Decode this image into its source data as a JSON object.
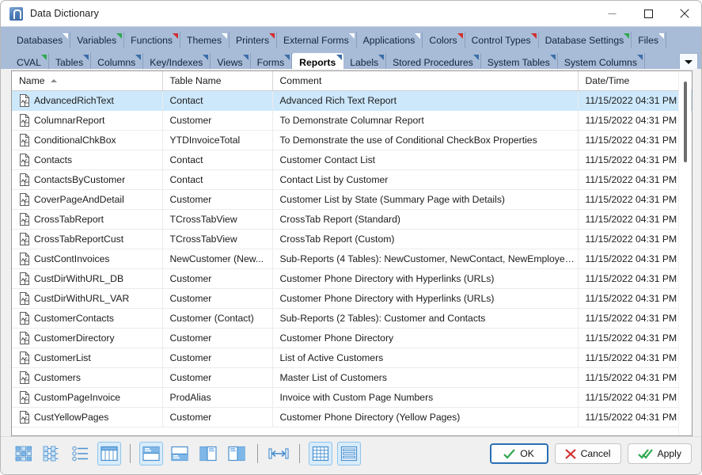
{
  "window": {
    "title": "Data Dictionary",
    "icon": "app-icon",
    "minimize_label": "—",
    "maximize_label": "□",
    "close_label": "✕"
  },
  "tabs": {
    "row1": [
      {
        "label": "Databases",
        "flag": "#ffffff"
      },
      {
        "label": "Variables",
        "flag": "#2fa84f"
      },
      {
        "label": "Functions",
        "flag": "#d32f2f"
      },
      {
        "label": "Themes",
        "flag": "#ffffff"
      },
      {
        "label": "Printers",
        "flag": "#d32f2f"
      },
      {
        "label": "External Forms",
        "flag": "#ffffff"
      },
      {
        "label": "Applications",
        "flag": "#ffffff"
      },
      {
        "label": "Colors",
        "flag": "#d32f2f"
      },
      {
        "label": "Control Types",
        "flag": "#d32f2f"
      },
      {
        "label": "Database Settings",
        "flag": "#2fa84f"
      },
      {
        "label": "Files",
        "flag": "#ffffff"
      }
    ],
    "row2": [
      {
        "label": "CVAL",
        "flag": "#2fa84f",
        "active": false
      },
      {
        "label": "Tables",
        "flag": "#3c6ea8",
        "active": false
      },
      {
        "label": "Columns",
        "flag": "#3c6ea8",
        "active": false
      },
      {
        "label": "Key/Indexes",
        "flag": "#3c6ea8",
        "active": false
      },
      {
        "label": "Views",
        "flag": "#3c6ea8",
        "active": false
      },
      {
        "label": "Forms",
        "flag": "#3c6ea8",
        "active": false
      },
      {
        "label": "Reports",
        "flag": "#3c6ea8",
        "active": true
      },
      {
        "label": "Labels",
        "flag": "#3c6ea8",
        "active": false
      },
      {
        "label": "Stored Procedures",
        "flag": "#3c6ea8",
        "active": false
      },
      {
        "label": "System Tables",
        "flag": "#3c6ea8",
        "active": false
      },
      {
        "label": "System Columns",
        "flag": "#3c6ea8",
        "active": false
      }
    ],
    "overflow_label": "▼"
  },
  "grid": {
    "columns": [
      "Name",
      "Table Name",
      "Comment",
      "Date/Time"
    ],
    "sort_column": "Name",
    "sort_direction": "ascending",
    "selected_row_index": 0,
    "rows": [
      {
        "name": "AdvancedRichText",
        "table": "Contact",
        "comment": "Advanced Rich Text Report",
        "date": "11/15/2022 04:31 PM"
      },
      {
        "name": "ColumnarReport",
        "table": "Customer",
        "comment": "To Demonstrate Columnar Report",
        "date": "11/15/2022 04:31 PM"
      },
      {
        "name": "ConditionalChkBox",
        "table": "YTDInvoiceTotal",
        "comment": "To Demonstrate the use of Conditional CheckBox  Properties",
        "date": "11/15/2022 04:31 PM"
      },
      {
        "name": "Contacts",
        "table": "Contact",
        "comment": "Customer Contact List",
        "date": "11/15/2022 04:31 PM"
      },
      {
        "name": "ContactsByCustomer",
        "table": "Contact",
        "comment": "Contact List by Customer",
        "date": "11/15/2022 04:31 PM"
      },
      {
        "name": "CoverPageAndDetail",
        "table": "Customer",
        "comment": "Customer List by State (Summary Page with Details)",
        "date": "11/15/2022 04:31 PM"
      },
      {
        "name": "CrossTabReport",
        "table": "TCrossTabView",
        "comment": "CrossTab Report (Standard)",
        "date": "11/15/2022 04:31 PM"
      },
      {
        "name": "CrossTabReportCust",
        "table": "TCrossTabView",
        "comment": "CrossTab Report (Custom)",
        "date": "11/15/2022 04:31 PM"
      },
      {
        "name": "CustContInvoices",
        "table": "NewCustomer (New...",
        "comment": "Sub-Reports (4 Tables): NewCustomer, NewContact, NewEmployee, ...",
        "date": "11/15/2022 04:31 PM"
      },
      {
        "name": "CustDirWithURL_DB",
        "table": "Customer",
        "comment": "Customer Phone Directory with Hyperlinks (URLs)",
        "date": "11/15/2022 04:31 PM"
      },
      {
        "name": "CustDirWithURL_VAR",
        "table": "Customer",
        "comment": "Customer Phone Directory with Hyperlinks (URLs)",
        "date": "11/15/2022 04:31 PM"
      },
      {
        "name": "CustomerContacts",
        "table": "Customer (Contact)",
        "comment": "Sub-Reports (2 Tables): Customer and Contacts",
        "date": "11/15/2022 04:31 PM"
      },
      {
        "name": "CustomerDirectory",
        "table": "Customer",
        "comment": "Customer Phone Directory",
        "date": "11/15/2022 04:31 PM"
      },
      {
        "name": "CustomerList",
        "table": "Customer",
        "comment": "List of Active Customers",
        "date": "11/15/2022 04:31 PM"
      },
      {
        "name": "Customers",
        "table": "Customer",
        "comment": "Master List of Customers",
        "date": "11/15/2022 04:31 PM"
      },
      {
        "name": "CustomPageInvoice",
        "table": "ProdAlias",
        "comment": "Invoice with Custom Page Numbers",
        "date": "11/15/2022 04:31 PM"
      },
      {
        "name": "CustYellowPages",
        "table": "Customer",
        "comment": "Customer Phone Directory (Yellow Pages)",
        "date": "11/15/2022 04:31 PM"
      }
    ]
  },
  "toolbar": {
    "buttons": [
      {
        "name": "large-icons-view-button",
        "icon": "large-icons-icon",
        "active": false
      },
      {
        "name": "small-icons-view-button",
        "icon": "small-icons-icon",
        "active": false
      },
      {
        "name": "list-view-button",
        "icon": "list-icon",
        "active": false
      },
      {
        "name": "details-grid-view-button",
        "icon": "grid-columns-icon",
        "active": true
      },
      {
        "name": "preview-top-button",
        "icon": "preview-top-icon",
        "active": true
      },
      {
        "name": "preview-bottom-button",
        "icon": "preview-bottom-icon",
        "active": false
      },
      {
        "name": "preview-left-button",
        "icon": "preview-left-icon",
        "active": false
      },
      {
        "name": "preview-right-button",
        "icon": "preview-right-icon",
        "active": false
      },
      {
        "name": "fit-width-button",
        "icon": "fit-width-icon",
        "active": false
      },
      {
        "name": "table-layout-button",
        "icon": "table-layout-icon",
        "active": true
      },
      {
        "name": "row-layout-button",
        "icon": "row-layout-icon",
        "active": true
      }
    ]
  },
  "actions": {
    "ok": "OK",
    "cancel": "Cancel",
    "apply": "Apply"
  },
  "colors": {
    "tabstrip": "#a8bcd8",
    "selection": "#cde8fb",
    "accent": "#2a6fb5",
    "ok_check": "#2fa84f",
    "cancel_x": "#d32f2f"
  }
}
